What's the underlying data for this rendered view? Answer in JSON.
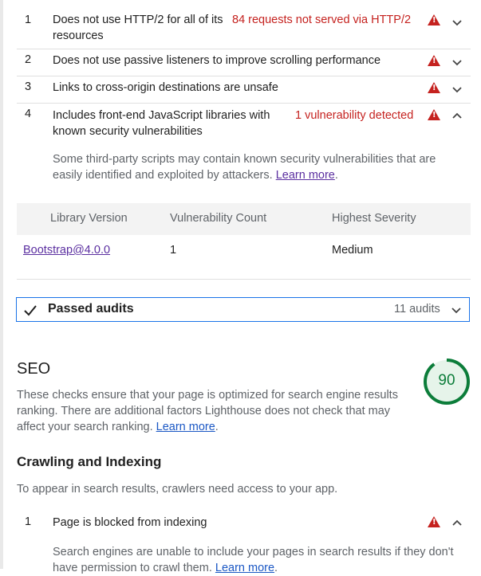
{
  "audits": [
    {
      "number": "1",
      "title": "Does not use HTTP/2 for all of its resources",
      "display": "84 requests not served via HTTP/2"
    },
    {
      "number": "2",
      "title": "Does not use passive listeners to improve scrolling performance",
      "display": ""
    },
    {
      "number": "3",
      "title": "Links to cross-origin destinations are unsafe",
      "display": ""
    },
    {
      "number": "4",
      "title": "Includes front-end JavaScript libraries with known security vulnerabilities",
      "display": "1 vulnerability detected",
      "description": "Some third-party scripts may contain known security vulnerabilities that are easily identified and exploited by attackers.",
      "learn_more": "Learn more"
    }
  ],
  "vuln_table": {
    "headers": [
      "Library Version",
      "Vulnerability Count",
      "Highest Severity"
    ],
    "rows": [
      [
        "Bootstrap@4.0.0",
        "1",
        "Medium"
      ]
    ]
  },
  "passed_audits": {
    "label": "Passed audits",
    "count": "11 audits"
  },
  "seo": {
    "title": "SEO",
    "score": "90",
    "score_fraction": 0.9,
    "description": "These checks ensure that your page is optimized for search engine results ranking. There are additional factors Lighthouse does not check that may affect your search ranking.",
    "learn_more": "Learn more"
  },
  "crawling": {
    "title": "Crawling and Indexing",
    "description": "To appear in search results, crawlers need access to your app.",
    "audit": {
      "number": "1",
      "title": "Page is blocked from indexing",
      "description": "Search engines are unable to include your pages in search results if they don't have permission to crawl them.",
      "learn_more": "Learn more"
    }
  },
  "colors": {
    "fail": "#c5221f",
    "pass": "#0c7d3a",
    "link": "#1a57c4",
    "focus": "#1a73e8"
  },
  "icons": [
    "warning-triangle-icon",
    "chevron-down-icon",
    "chevron-up-icon",
    "checkmark-icon"
  ]
}
